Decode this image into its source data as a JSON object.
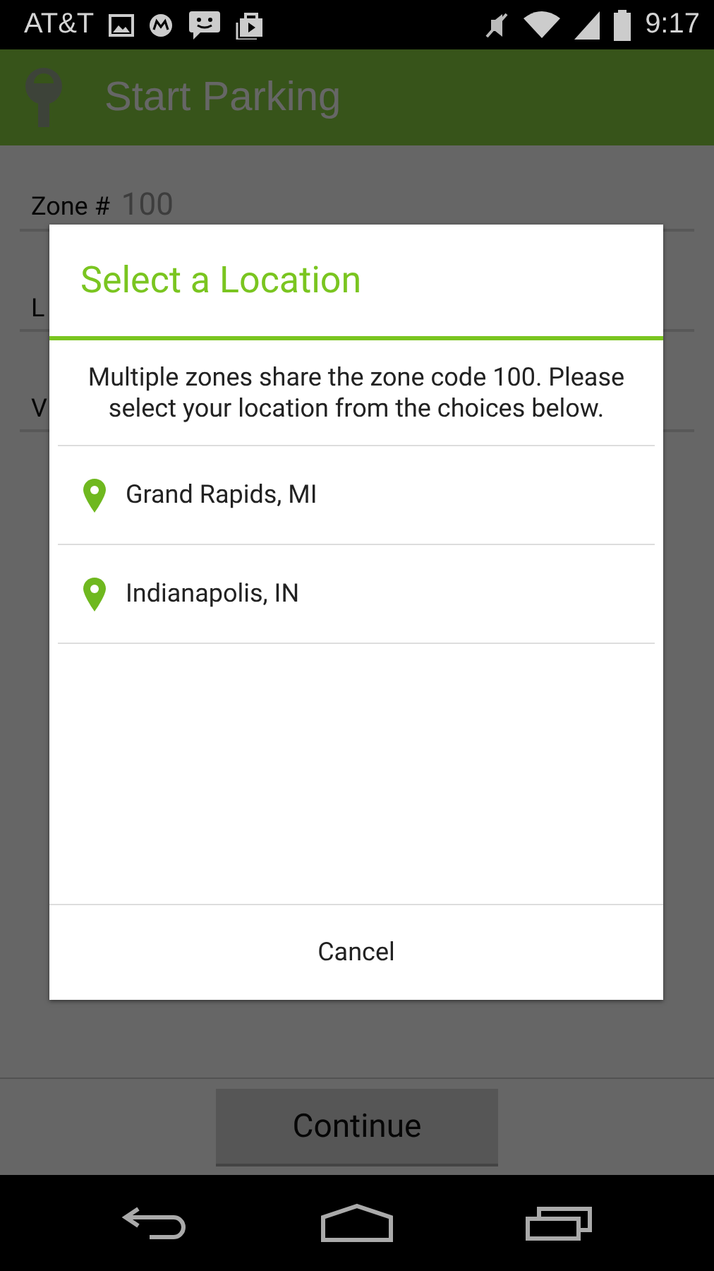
{
  "status_bar": {
    "carrier": "AT&T",
    "time": "9:17"
  },
  "app_bar": {
    "title": "Start Parking"
  },
  "form": {
    "fields": [
      {
        "label": "Zone #",
        "value": "100"
      },
      {
        "label": "L"
      },
      {
        "label": "V"
      }
    ]
  },
  "dialog": {
    "title": "Select a Location",
    "message": "Multiple zones share the zone code 100. Please select your location from the choices below.",
    "locations": [
      {
        "name": "Grand Rapids, MI"
      },
      {
        "name": "Indianapolis, IN"
      }
    ],
    "cancel": "Cancel"
  },
  "footer": {
    "button": "Continue"
  }
}
